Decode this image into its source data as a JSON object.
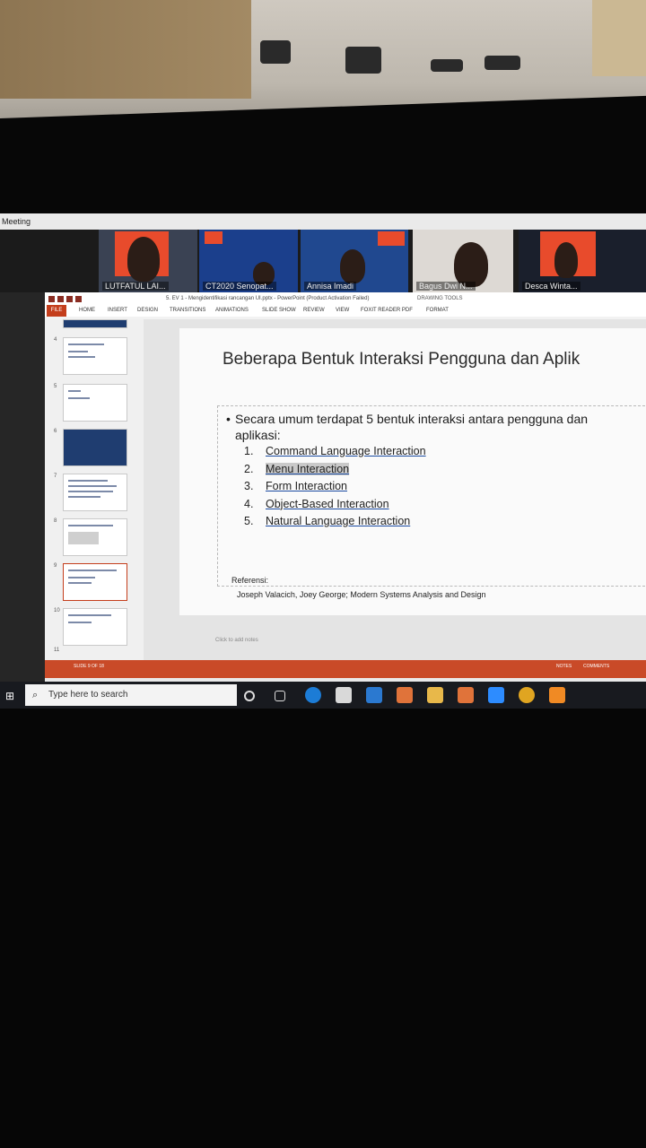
{
  "meeting": {
    "title": "Meeting",
    "participants": [
      {
        "name": "LUTFATUL LAI..."
      },
      {
        "name": "CT2020 Senopat..."
      },
      {
        "name": "Annisa Imadi"
      },
      {
        "name": "Bagus Dwi N..."
      },
      {
        "name": "Desca Winta..."
      }
    ],
    "side_label": "ecording"
  },
  "powerpoint": {
    "window_title": "5. EV 1 - Mengidentifikasi rancangan UI.pptx - PowerPoint (Product Activation Failed)",
    "context_group": "DRAWING TOOLS",
    "tabs": [
      "FILE",
      "HOME",
      "INSERT",
      "DESIGN",
      "TRANSITIONS",
      "ANIMATIONS",
      "SLIDE SHOW",
      "REVIEW",
      "VIEW",
      "FOXIT READER PDF",
      "FORMAT"
    ],
    "thumbnail_numbers": [
      "4",
      "5",
      "6",
      "7",
      "8",
      "9",
      "10",
      "11"
    ],
    "notes_placeholder": "Click to add notes",
    "status_left": "SLIDE 9 OF 18",
    "status_notes": "NOTES",
    "status_comments": "COMMENTS"
  },
  "slide": {
    "title": "Beberapa Bentuk Interaksi Pengguna dan Aplik",
    "intro_line1": "Secara umum terdapat 5 bentuk interaksi antara pengguna dan",
    "intro_line2": "aplikasi:",
    "items": [
      {
        "num": "1.",
        "text": "Command Language Interaction"
      },
      {
        "num": "2.",
        "text": "Menu Interaction"
      },
      {
        "num": "3.",
        "text": "Form Interaction"
      },
      {
        "num": "4.",
        "text": "Object-Based Interaction"
      },
      {
        "num": "5.",
        "text": "Natural Language Interaction"
      }
    ],
    "ref_label": "Referensi:",
    "ref_text": "Joseph Valacich, Joey George; Modern Systems Analysis and Design"
  },
  "taskbar": {
    "search_placeholder": "Type here to search"
  },
  "colors": {
    "ppt_accent": "#c43e1c",
    "zoom_tile_accent": "#e84b2c"
  }
}
